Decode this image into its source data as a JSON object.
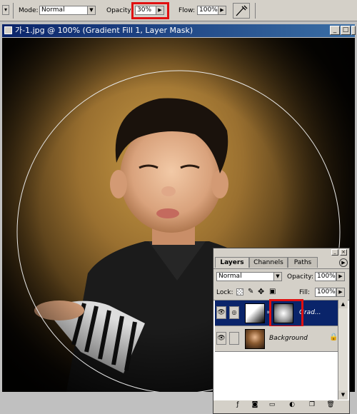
{
  "options": {
    "mode_label": "Mode:",
    "mode_value": "Normal",
    "opacity_label": "Opacity:",
    "opacity_value": "30%",
    "flow_label": "Flow:",
    "flow_value": "100%"
  },
  "document": {
    "title": "가-1.jpg @ 100% (Gradient Fill 1, Layer Mask)"
  },
  "layers_panel": {
    "tabs": [
      "Layers",
      "Channels",
      "Paths"
    ],
    "blend_mode": "Normal",
    "opacity_label": "Opacity:",
    "opacity_value": "100%",
    "lock_label": "Lock:",
    "fill_label": "Fill:",
    "fill_value": "100%",
    "layers": [
      {
        "name": "Grad..."
      },
      {
        "name": "Background"
      }
    ]
  },
  "colors": {
    "highlight": "#e01010",
    "selected_layer": "#0a246a"
  }
}
